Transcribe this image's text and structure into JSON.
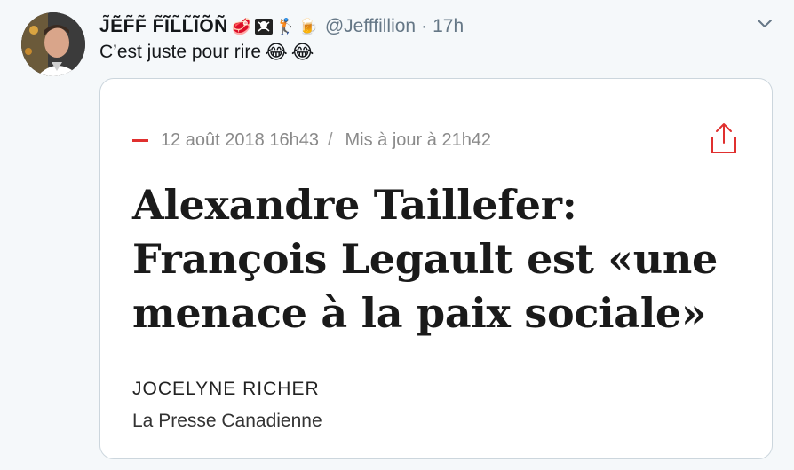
{
  "tweet": {
    "display_name": "J̃ẼF̃F̃ F̃ĨL̃L̃ĨÕÑ",
    "name_emojis": [
      {
        "icon": "steak-icon",
        "glyph": "🥩"
      },
      {
        "icon": "pirate-flag-icon",
        "glyph": "☠"
      },
      {
        "icon": "golfer-icon",
        "glyph": "🏌"
      },
      {
        "icon": "beer-icon",
        "glyph": "🍺"
      }
    ],
    "handle": "@Jefffillion",
    "separator": "·",
    "time": "17h",
    "text": "C’est juste pour rire",
    "text_emojis": [
      "😂",
      "😂"
    ]
  },
  "card": {
    "date": "12 août 2018 16h43",
    "separator": "/",
    "updated": "Mis à jour à 21h42",
    "headline": "Alexandre Taillefer: François Legault est «une menace à la paix sociale»",
    "author": "JOCELYNE RICHER",
    "agency": "La Presse Canadienne"
  },
  "colors": {
    "accent_red": "#e0302f",
    "muted_text": "#657786",
    "background": "#f5f8fa",
    "card_border": "#ccd6dd"
  }
}
